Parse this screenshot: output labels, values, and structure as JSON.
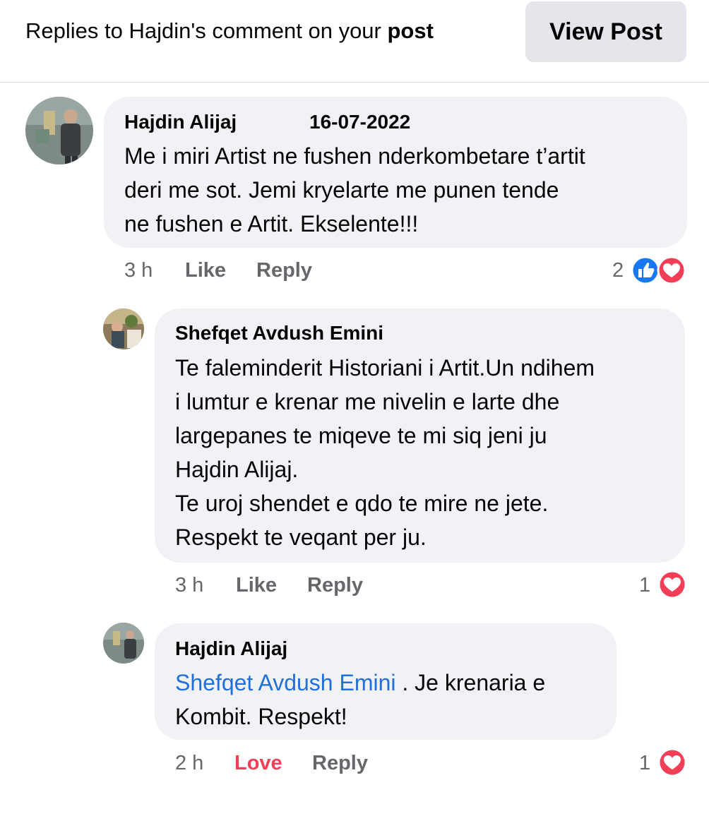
{
  "header": {
    "text": "Replies to Hajdin's comment on your",
    "text_bold": "post",
    "view_post_label": "View Post"
  },
  "comments": [
    {
      "author": "Hajdin Alijaj",
      "date": "16-07-2022",
      "lines": [
        "Me i miri Artist ne fushen nderkombetare t’artit",
        "deri me sot. Jemi kryelarte me punen tende",
        "ne fushen e Artit. Ekselente!!!"
      ],
      "time": "3 h",
      "action_like": "Like",
      "action_reply": "Reply",
      "reaction_count": "2",
      "reactions": [
        "like-icon",
        "love-icon"
      ]
    },
    {
      "author": "Shefqet Avdush Emini",
      "lines": [
        "Te faleminderit Historiani i Artit.Un ndihem",
        "i lumtur e krenar me nivelin e larte dhe",
        "largepanes te miqeve te mi siq jeni ju",
        "Hajdin Alijaj.",
        "Te uroj shendet e qdo te mire ne jete.",
        "Respekt te veqant per ju."
      ],
      "time": "3 h",
      "action_like": "Like",
      "action_reply": "Reply",
      "reaction_count": "1",
      "reactions": [
        "love-icon"
      ]
    },
    {
      "author": "Hajdin Alijaj",
      "mention": "Shefqet Avdush Emini",
      "line1_rest": " . Je krenaria e",
      "line2": "Kombit. Respekt!",
      "time": "2 h",
      "action_like": "Love",
      "action_reply": "Reply",
      "reaction_count": "1",
      "reactions": [
        "love-icon"
      ]
    }
  ],
  "colors": {
    "like_blue": "#1877f2",
    "love_red": "#f33e58",
    "mention_blue": "#216fdb",
    "bubble_bg": "#f0f2f5"
  }
}
